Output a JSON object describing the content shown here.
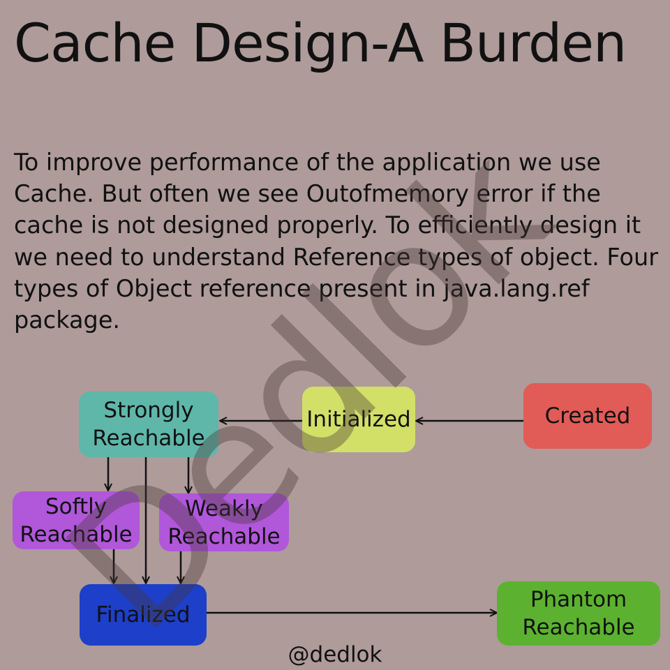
{
  "title": "Cache Design-A Burden",
  "paragraph": "To improve performance of the application we use Cache. But often we see Outofmemory error  if the cache is not designed properly. To efficiently design it we need to understand Reference types of object. Four types of Object reference present in java.lang.ref package.",
  "watermark": "Dedlok",
  "nodes": {
    "strongly": {
      "label": "Strongly\nReachable",
      "color": "#5fb7aa"
    },
    "initialized": {
      "label": "Initialized",
      "color": "#d2e068"
    },
    "created": {
      "label": "Created",
      "color": "#e15b57"
    },
    "softly": {
      "label": "Softly\nReachable",
      "color": "#b057da"
    },
    "weakly": {
      "label": "Weakly\nReachable",
      "color": "#b057da"
    },
    "finalized": {
      "label": "Finalized",
      "color": "#1d3fca"
    },
    "phantom": {
      "label": "Phantom\nReachable",
      "color": "#5cb230"
    }
  },
  "edges": [
    {
      "from": "created",
      "to": "initialized"
    },
    {
      "from": "initialized",
      "to": "strongly"
    },
    {
      "from": "strongly",
      "to": "softly"
    },
    {
      "from": "strongly",
      "to": "weakly"
    },
    {
      "from": "strongly",
      "to": "finalized"
    },
    {
      "from": "softly",
      "to": "finalized"
    },
    {
      "from": "weakly",
      "to": "finalized"
    },
    {
      "from": "finalized",
      "to": "phantom"
    }
  ],
  "footer": "@dedlok"
}
